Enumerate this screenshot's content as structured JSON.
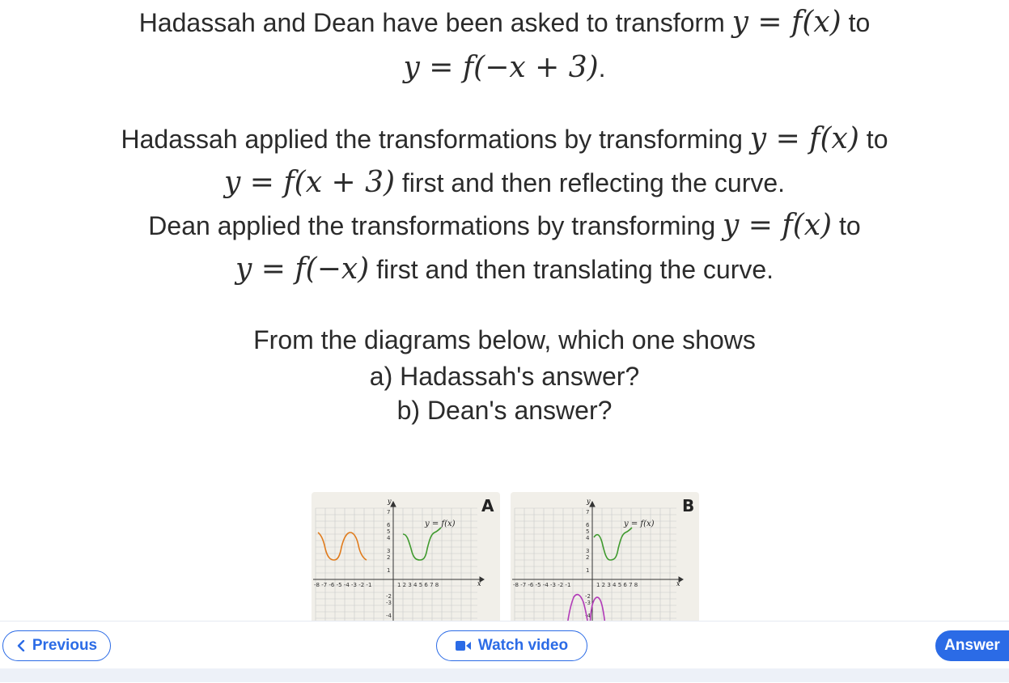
{
  "question": {
    "line1_pre": "Hadassah and Dean have been asked to transform ",
    "line1_math": "y = f(x)",
    "line1_post": " to",
    "line2_math": "y = f(−x + 3)",
    "line2_post": ".",
    "line3_pre": "Hadassah applied the transformations by transforming ",
    "line3_math": "y = f(x)",
    "line3_post": " to",
    "line4_math": "y = f(x + 3)",
    "line4_post": " first and then reflecting the curve.",
    "line5_pre": "Dean applied the transformations by transforming ",
    "line5_math": "y = f(x)",
    "line5_post": " to",
    "line6_math": "y = f(−x)",
    "line6_post": " first and then translating the curve.",
    "prompt": "From the diagrams below, which one shows",
    "part_a": "a) Hadassah's answer?",
    "part_b": "b) Dean's answer?"
  },
  "diagrams": [
    {
      "letter": "A",
      "curve_label": "y = f(x)",
      "x_label": "x",
      "y_label": "y",
      "second_curve_color": "#e07b1c"
    },
    {
      "letter": "B",
      "curve_label": "y = f(x)",
      "x_label": "x",
      "y_label": "y",
      "second_curve_color": "#b23bb8"
    }
  ],
  "footer": {
    "previous_label": "Previous",
    "watch_label": "Watch video",
    "answer_label": "Answer"
  },
  "colors": {
    "accent": "#2b6be6",
    "curve": "#3f9a2e"
  }
}
